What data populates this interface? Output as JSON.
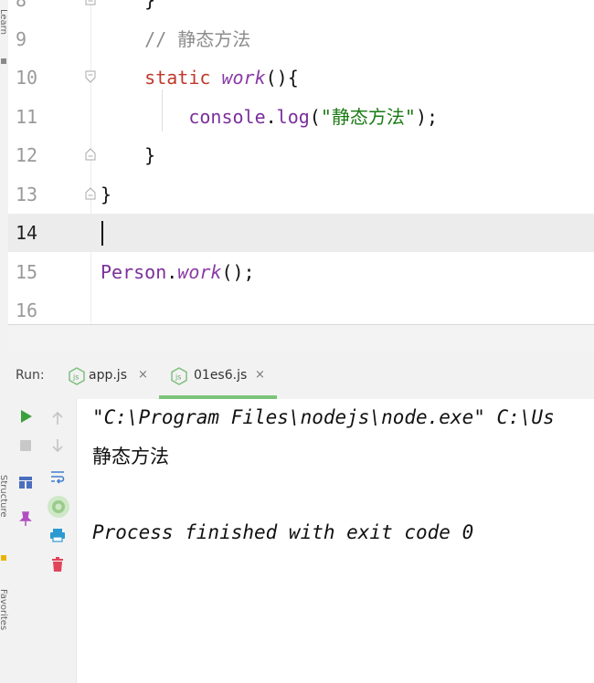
{
  "editor": {
    "lines": [
      {
        "num": "8",
        "parts": [
          {
            "t": "    }",
            "c": ""
          }
        ]
      },
      {
        "num": "9",
        "parts": [
          {
            "t": "    // 静态方法",
            "c": "comment"
          }
        ]
      },
      {
        "num": "10",
        "parts": [
          {
            "t": "    ",
            "c": ""
          },
          {
            "t": "static",
            "c": "kw"
          },
          {
            "t": " ",
            "c": ""
          },
          {
            "t": "work",
            "c": "fn"
          },
          {
            "t": "(){",
            "c": ""
          }
        ]
      },
      {
        "num": "11",
        "parts": [
          {
            "t": "        ",
            "c": ""
          },
          {
            "t": "console",
            "c": "ident"
          },
          {
            "t": ".",
            "c": ""
          },
          {
            "t": "log",
            "c": "ident"
          },
          {
            "t": "(",
            "c": ""
          },
          {
            "t": "\"静态方法\"",
            "c": "str"
          },
          {
            "t": ");",
            "c": ""
          }
        ]
      },
      {
        "num": "12",
        "parts": [
          {
            "t": "    }",
            "c": ""
          }
        ]
      },
      {
        "num": "13",
        "parts": [
          {
            "t": "}",
            "c": ""
          }
        ]
      },
      {
        "num": "14",
        "parts": [],
        "current": true
      },
      {
        "num": "15",
        "parts": [
          {
            "t": "Person",
            "c": "ident"
          },
          {
            "t": ".",
            "c": ""
          },
          {
            "t": "work",
            "c": "fn"
          },
          {
            "t": "();",
            "c": ""
          }
        ]
      },
      {
        "num": "16",
        "parts": []
      }
    ]
  },
  "run_panel": {
    "label": "Run:",
    "tabs": [
      {
        "label": "app.js",
        "close": "×",
        "active": false
      },
      {
        "label": "01es6.js",
        "close": "×",
        "active": true
      }
    ],
    "console": [
      "\"C:\\Program Files\\nodejs\\node.exe\" C:\\Us",
      "静态方法",
      "",
      "Process finished with exit code 0"
    ]
  },
  "tool_strip": {
    "labels": [
      "Learn",
      "Structure",
      "Favorites"
    ]
  },
  "colors": {
    "keyword": "#c0392b",
    "function": "#8a3aa6",
    "string": "#1a7a14",
    "comment": "#8c8c8c",
    "active_tab_underline": "#7cc47a",
    "run_green": "#3ca03c"
  },
  "icons": [
    "run-icon",
    "stop-icon",
    "up-arrow-icon",
    "down-arrow-icon",
    "soft-wrap-icon",
    "layout-icon",
    "pin-icon",
    "settings-icon",
    "print-icon",
    "trash-icon",
    "nodejs-icon",
    "fold-icon"
  ]
}
